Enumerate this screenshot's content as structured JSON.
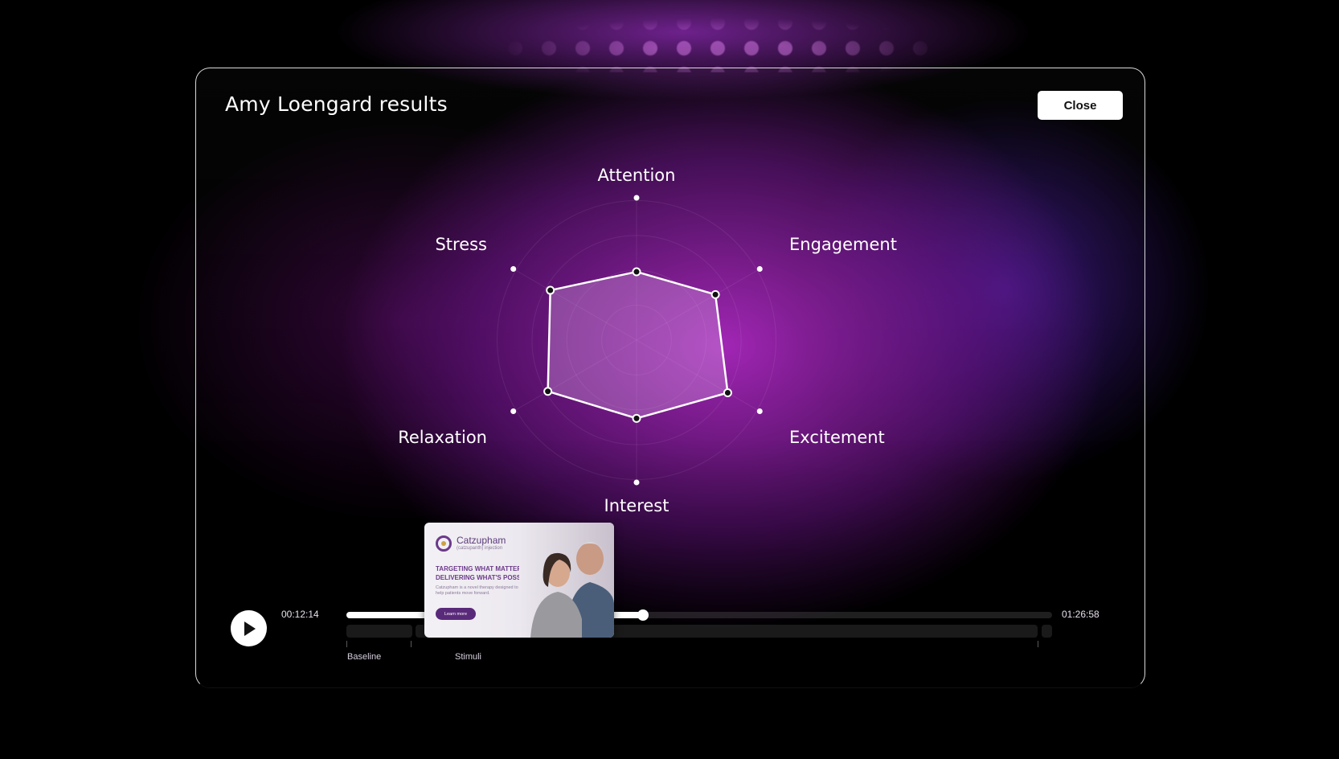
{
  "modal": {
    "title": "Amy Loengard results",
    "close_label": "Close"
  },
  "chart_data": {
    "type": "radar",
    "axes": [
      "Attention",
      "Engagement",
      "Excitement",
      "Interest",
      "Relaxation",
      "Stress"
    ],
    "values": [
      0.48,
      0.64,
      0.74,
      0.55,
      0.72,
      0.7
    ],
    "range": [
      0,
      1
    ],
    "grid": "concentric circles",
    "fill_color": "#d9a6e8",
    "stroke_color": "#ffffff"
  },
  "player": {
    "current_time": "00:12:14",
    "total_time": "01:26:58",
    "progress": 0.42,
    "segments": [
      {
        "label": "Baseline",
        "start": 0,
        "end": 0.093
      },
      {
        "label": "Stimuli",
        "start": 0.098,
        "end": 0.98
      },
      {
        "label": "",
        "start": 0.985,
        "end": 1.0
      }
    ],
    "segment_labels": [
      "Baseline",
      "Stimuli"
    ]
  },
  "preview": {
    "brand": "Catzupham",
    "brand_sub": "(catzupanth) injection",
    "headline": "TARGETING WHAT MATTERS. DELIVERING WHAT'S POSSIBLE.",
    "body": "Catzupham is a novel therapy designed to help patients move forward.",
    "cta": "Learn more"
  },
  "icons": {
    "play": "play-icon",
    "logo": "catzupham-logo-icon"
  }
}
